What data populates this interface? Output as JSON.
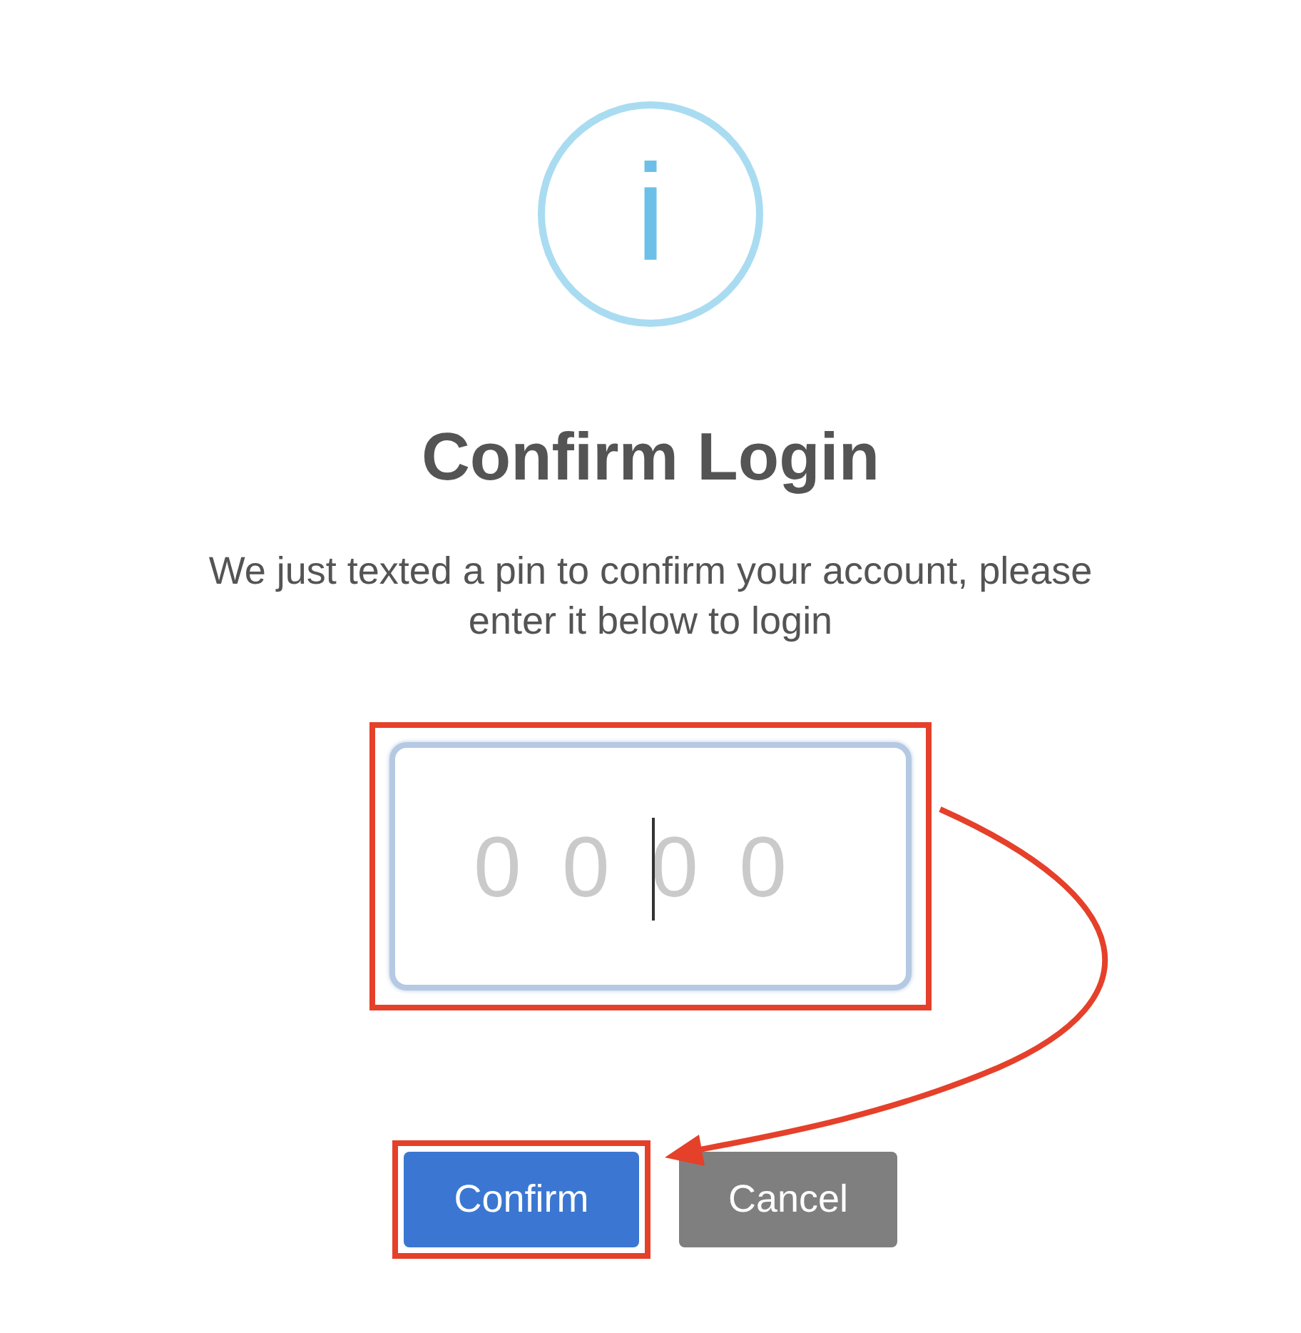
{
  "icon": {
    "glyph": "i"
  },
  "title": "Confirm Login",
  "message": "We just texted a pin to confirm your account, please enter it below to login",
  "pin_field": {
    "placeholder": "0 0 0 0",
    "focused": true,
    "highlighted": true
  },
  "buttons": [
    {
      "label": "Confirm",
      "kind": "primary",
      "highlighted": true
    },
    {
      "label": "Cancel",
      "kind": "secondary",
      "highlighted": false
    }
  ],
  "annotation_arrow": true
}
